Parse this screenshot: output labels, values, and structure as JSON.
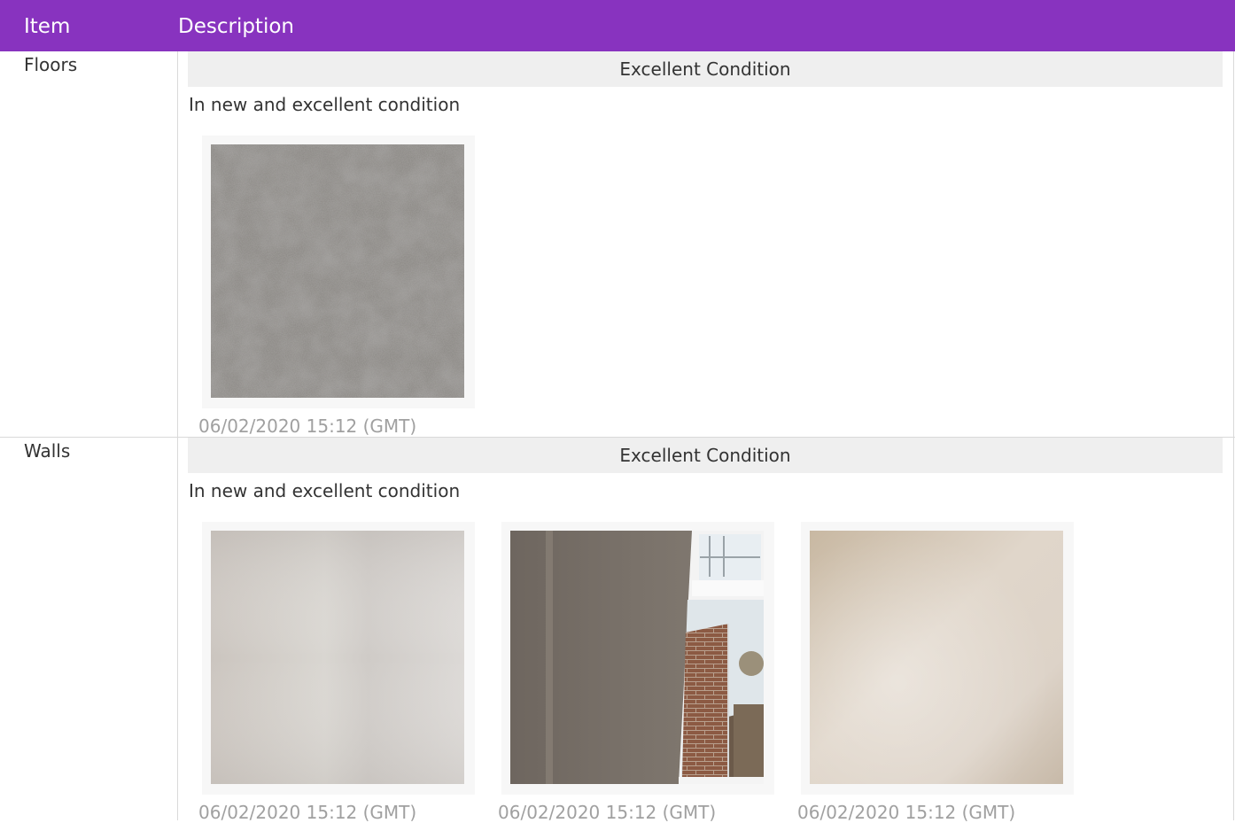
{
  "table": {
    "headers": {
      "item": "Item",
      "description": "Description"
    },
    "rows": [
      {
        "item": "Floors",
        "condition": "Excellent Condition",
        "description": "In new and excellent condition",
        "photos": [
          {
            "subject": "grey carpet",
            "timestamp": "06/02/2020 15:12 (GMT)"
          }
        ]
      },
      {
        "item": "Walls",
        "condition": "Excellent Condition",
        "description": "In new and excellent condition",
        "photos": [
          {
            "subject": "plain painted wall",
            "timestamp": "06/02/2020 15:12 (GMT)"
          },
          {
            "subject": "wall corner with window",
            "timestamp": "06/02/2020 15:12 (GMT)"
          },
          {
            "subject": "plain painted wall",
            "timestamp": "06/02/2020 15:12 (GMT)"
          }
        ]
      }
    ]
  },
  "colors": {
    "header_background": "#8833bf",
    "condition_background": "#efefef",
    "timestamp_text": "#a0a0a0"
  }
}
